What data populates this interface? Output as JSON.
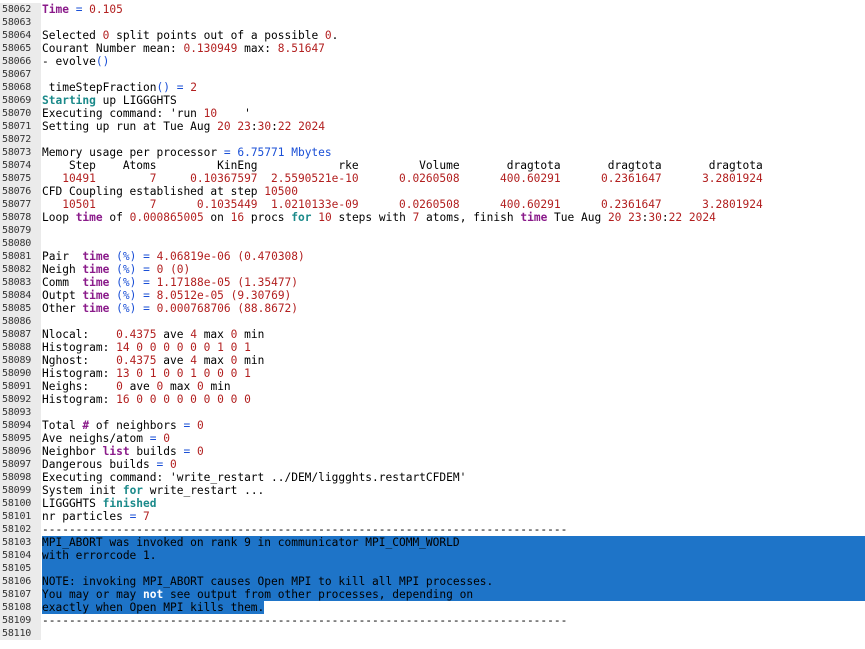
{
  "lines": [
    {
      "n": "58062",
      "segs": [
        [
          "kw",
          "Time"
        ],
        [
          "op",
          " = "
        ],
        [
          "num",
          "0.105"
        ]
      ]
    },
    {
      "n": "58063",
      "segs": []
    },
    {
      "n": "58064",
      "segs": [
        [
          "t",
          "Selected "
        ],
        [
          "num",
          "0"
        ],
        [
          "t",
          " split points out of a possible "
        ],
        [
          "num",
          "0"
        ],
        [
          "t",
          "."
        ]
      ]
    },
    {
      "n": "58065",
      "segs": [
        [
          "t",
          "Courant Number mean: "
        ],
        [
          "num",
          "0.130949"
        ],
        [
          "t",
          " max: "
        ],
        [
          "num",
          "8.51647"
        ]
      ]
    },
    {
      "n": "58066",
      "segs": [
        [
          "t",
          "- evolve"
        ],
        [
          "op",
          "()"
        ]
      ]
    },
    {
      "n": "58067",
      "segs": []
    },
    {
      "n": "58068",
      "segs": [
        [
          "t",
          " timeStepFraction"
        ],
        [
          "op",
          "()"
        ],
        [
          "op",
          " = "
        ],
        [
          "num",
          "2"
        ]
      ]
    },
    {
      "n": "58069",
      "segs": [
        [
          "grn",
          "Starting"
        ],
        [
          "t",
          " up LIGGGHTS"
        ]
      ]
    },
    {
      "n": "58070",
      "segs": [
        [
          "t",
          "Executing command: 'run "
        ],
        [
          "num",
          "10"
        ],
        [
          "t",
          "    '"
        ]
      ]
    },
    {
      "n": "58071",
      "segs": [
        [
          "t",
          "Setting up run at Tue Aug "
        ],
        [
          "num",
          "20"
        ],
        [
          "t",
          " "
        ],
        [
          "num",
          "23"
        ],
        [
          "t",
          ":"
        ],
        [
          "num",
          "30"
        ],
        [
          "t",
          ":"
        ],
        [
          "num",
          "22"
        ],
        [
          "t",
          " "
        ],
        [
          "num",
          "2024"
        ]
      ]
    },
    {
      "n": "58072",
      "segs": []
    },
    {
      "n": "58073",
      "segs": [
        [
          "t",
          "Memory usage per processor "
        ],
        [
          "op",
          "= "
        ],
        [
          "blue",
          "6.75771 Mbytes"
        ]
      ]
    },
    {
      "n": "58074",
      "segs": [
        [
          "t",
          "    Step    Atoms         KinEng            rke         Volume       dragtota       dragtota       dragtota"
        ]
      ]
    },
    {
      "n": "58075",
      "segs": [
        [
          "num",
          "   10491        7     0.10367597  2.5590521e-10      0.0260508      400.60291      0.2361647      3.2801924"
        ]
      ]
    },
    {
      "n": "58076",
      "segs": [
        [
          "t",
          "CFD Coupling established at step "
        ],
        [
          "num",
          "10500"
        ]
      ]
    },
    {
      "n": "58077",
      "segs": [
        [
          "num",
          "   10501        7      0.1035449  1.0210133e-09      0.0260508      400.60291      0.2361647      3.2801924"
        ]
      ]
    },
    {
      "n": "58078",
      "segs": [
        [
          "t",
          "Loop "
        ],
        [
          "kw",
          "time"
        ],
        [
          "t",
          " of "
        ],
        [
          "num",
          "0.000865005"
        ],
        [
          "t",
          " on "
        ],
        [
          "num",
          "16"
        ],
        [
          "t",
          " procs "
        ],
        [
          "grn",
          "for"
        ],
        [
          "t",
          " "
        ],
        [
          "num",
          "10"
        ],
        [
          "t",
          " steps with "
        ],
        [
          "num",
          "7"
        ],
        [
          "t",
          " atoms, finish "
        ],
        [
          "kw",
          "time"
        ],
        [
          "t",
          " Tue Aug "
        ],
        [
          "num",
          "20"
        ],
        [
          "t",
          " "
        ],
        [
          "num",
          "23"
        ],
        [
          "t",
          ":"
        ],
        [
          "num",
          "30"
        ],
        [
          "t",
          ":"
        ],
        [
          "num",
          "22"
        ],
        [
          "t",
          " "
        ],
        [
          "num",
          "2024"
        ]
      ]
    },
    {
      "n": "58079",
      "segs": []
    },
    {
      "n": "58080",
      "segs": []
    },
    {
      "n": "58081",
      "segs": [
        [
          "t",
          "Pair  "
        ],
        [
          "kw",
          "time"
        ],
        [
          "t",
          " "
        ],
        [
          "op",
          "(%)"
        ],
        [
          "op",
          " = "
        ],
        [
          "num",
          "4.06819e-06"
        ],
        [
          "t",
          " "
        ],
        [
          "num",
          "(0.470308)"
        ]
      ]
    },
    {
      "n": "58082",
      "segs": [
        [
          "t",
          "Neigh "
        ],
        [
          "kw",
          "time"
        ],
        [
          "t",
          " "
        ],
        [
          "op",
          "(%)"
        ],
        [
          "op",
          " = "
        ],
        [
          "num",
          "0"
        ],
        [
          "t",
          " "
        ],
        [
          "num",
          "(0)"
        ]
      ]
    },
    {
      "n": "58083",
      "segs": [
        [
          "t",
          "Comm  "
        ],
        [
          "kw",
          "time"
        ],
        [
          "t",
          " "
        ],
        [
          "op",
          "(%)"
        ],
        [
          "op",
          " = "
        ],
        [
          "num",
          "1.17188e-05"
        ],
        [
          "t",
          " "
        ],
        [
          "num",
          "(1.35477)"
        ]
      ]
    },
    {
      "n": "58084",
      "segs": [
        [
          "t",
          "Outpt "
        ],
        [
          "kw",
          "time"
        ],
        [
          "t",
          " "
        ],
        [
          "op",
          "(%)"
        ],
        [
          "op",
          " = "
        ],
        [
          "num",
          "8.0512e-05"
        ],
        [
          "t",
          " "
        ],
        [
          "num",
          "(9.30769)"
        ]
      ]
    },
    {
      "n": "58085",
      "segs": [
        [
          "t",
          "Other "
        ],
        [
          "kw",
          "time"
        ],
        [
          "t",
          " "
        ],
        [
          "op",
          "(%)"
        ],
        [
          "op",
          " = "
        ],
        [
          "num",
          "0.000768706"
        ],
        [
          "t",
          " "
        ],
        [
          "num",
          "(88.8672)"
        ]
      ]
    },
    {
      "n": "58086",
      "segs": []
    },
    {
      "n": "58087",
      "segs": [
        [
          "t",
          "Nlocal:    "
        ],
        [
          "num",
          "0.4375"
        ],
        [
          "t",
          " ave "
        ],
        [
          "num",
          "4"
        ],
        [
          "t",
          " max "
        ],
        [
          "num",
          "0"
        ],
        [
          "t",
          " min"
        ]
      ]
    },
    {
      "n": "58088",
      "segs": [
        [
          "t",
          "Histogram: "
        ],
        [
          "num",
          "14 0 0 0 0 0 0 1 0 1"
        ]
      ]
    },
    {
      "n": "58089",
      "segs": [
        [
          "t",
          "Nghost:    "
        ],
        [
          "num",
          "0.4375"
        ],
        [
          "t",
          " ave "
        ],
        [
          "num",
          "4"
        ],
        [
          "t",
          " max "
        ],
        [
          "num",
          "0"
        ],
        [
          "t",
          " min"
        ]
      ]
    },
    {
      "n": "58090",
      "segs": [
        [
          "t",
          "Histogram: "
        ],
        [
          "num",
          "13 0 1 0 0 1 0 0 0 1"
        ]
      ]
    },
    {
      "n": "58091",
      "segs": [
        [
          "t",
          "Neighs:    "
        ],
        [
          "num",
          "0"
        ],
        [
          "t",
          " ave "
        ],
        [
          "num",
          "0"
        ],
        [
          "t",
          " max "
        ],
        [
          "num",
          "0"
        ],
        [
          "t",
          " min"
        ]
      ]
    },
    {
      "n": "58092",
      "segs": [
        [
          "t",
          "Histogram: "
        ],
        [
          "num",
          "16 0 0 0 0 0 0 0 0 0"
        ]
      ]
    },
    {
      "n": "58093",
      "segs": []
    },
    {
      "n": "58094",
      "segs": [
        [
          "t",
          "Total "
        ],
        [
          "kw",
          "#"
        ],
        [
          "t",
          " of neighbors "
        ],
        [
          "op",
          "= "
        ],
        [
          "num",
          "0"
        ]
      ]
    },
    {
      "n": "58095",
      "segs": [
        [
          "t",
          "Ave neighs/atom "
        ],
        [
          "op",
          "= "
        ],
        [
          "num",
          "0"
        ]
      ]
    },
    {
      "n": "58096",
      "segs": [
        [
          "t",
          "Neighbor "
        ],
        [
          "kw",
          "list"
        ],
        [
          "t",
          " builds "
        ],
        [
          "op",
          "= "
        ],
        [
          "num",
          "0"
        ]
      ]
    },
    {
      "n": "58097",
      "segs": [
        [
          "t",
          "Dangerous builds "
        ],
        [
          "op",
          "= "
        ],
        [
          "num",
          "0"
        ]
      ]
    },
    {
      "n": "58098",
      "segs": [
        [
          "t",
          "Executing command: 'write_restart ../DEM/liggghts.restartCFDEM'"
        ]
      ]
    },
    {
      "n": "58099",
      "segs": [
        [
          "t",
          "System init "
        ],
        [
          "grn",
          "for"
        ],
        [
          "t",
          " write_restart ..."
        ]
      ]
    },
    {
      "n": "58100",
      "segs": [
        [
          "t",
          "LIGGGHTS "
        ],
        [
          "grn",
          "finished"
        ]
      ]
    },
    {
      "n": "58101",
      "segs": [
        [
          "t",
          "nr particles "
        ],
        [
          "op",
          "= "
        ],
        [
          "num",
          "7"
        ]
      ]
    },
    {
      "n": "58102",
      "segs": [
        [
          "t",
          "------------------------------------------------------------------------------"
        ]
      ]
    },
    {
      "n": "58103",
      "sel": "full",
      "segs": [
        [
          "t",
          "MPI_ABORT was invoked on rank 9 in communicator MPI_COMM_WORLD"
        ]
      ]
    },
    {
      "n": "58104",
      "sel": "full",
      "segs": [
        [
          "t",
          "with errorcode 1."
        ]
      ]
    },
    {
      "n": "58105",
      "sel": "full",
      "segs": []
    },
    {
      "n": "58106",
      "sel": "full",
      "segs": [
        [
          "t",
          "NOTE: invoking MPI_ABORT causes Open MPI to kill all MPI processes."
        ]
      ]
    },
    {
      "n": "58107",
      "sel": "full",
      "segs": [
        [
          "t",
          "You may or may "
        ],
        [
          "bold",
          "not"
        ],
        [
          "t",
          " see output from other processes, depending on"
        ]
      ]
    },
    {
      "n": "58108",
      "sel": "part",
      "segs": [
        [
          "t",
          "exactly when Open MPI kills them."
        ]
      ]
    },
    {
      "n": "58109",
      "segs": [
        [
          "t",
          "------------------------------------------------------------------------------"
        ]
      ]
    },
    {
      "n": "58110",
      "segs": []
    }
  ],
  "colors": {
    "selection": "#1e74c8",
    "keyword": "#8a1a8a",
    "number": "#b21f1f",
    "operator": "#1a4fd6",
    "teal": "#1b8a8a",
    "gutter": "#ebebeb"
  }
}
